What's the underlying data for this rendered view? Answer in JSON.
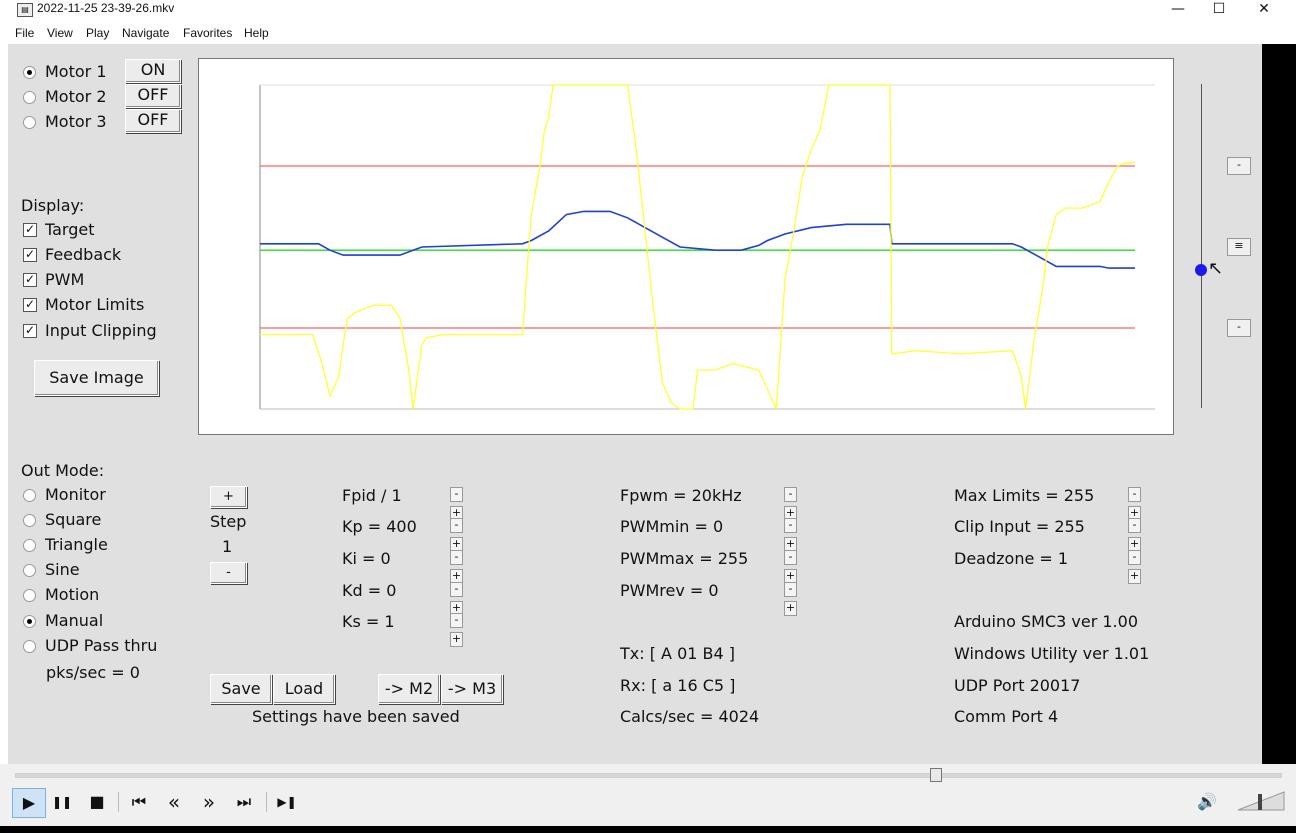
{
  "window": {
    "title": "2022-11-25 23-39-26.mkv",
    "minimize": "—",
    "maximize": "☐",
    "close": "✕"
  },
  "menu": [
    "File",
    "View",
    "Play",
    "Navigate",
    "Favorites",
    "Help"
  ],
  "motors": [
    {
      "label": "Motor 1",
      "selected": true,
      "state": "ON"
    },
    {
      "label": "Motor 2",
      "selected": false,
      "state": "OFF"
    },
    {
      "label": "Motor 3",
      "selected": false,
      "state": "OFF"
    }
  ],
  "display": {
    "heading": "Display:",
    "options": [
      {
        "label": "Target",
        "checked": true
      },
      {
        "label": "Feedback",
        "checked": true
      },
      {
        "label": "PWM",
        "checked": true
      },
      {
        "label": "Motor Limits",
        "checked": true
      },
      {
        "label": "Input Clipping",
        "checked": true
      }
    ],
    "save_image": "Save Image"
  },
  "out_mode": {
    "heading": "Out Mode:",
    "options": [
      {
        "label": "Monitor",
        "selected": false
      },
      {
        "label": "Square",
        "selected": false
      },
      {
        "label": "Triangle",
        "selected": false
      },
      {
        "label": "Sine",
        "selected": false
      },
      {
        "label": "Motion",
        "selected": false
      },
      {
        "label": "Manual",
        "selected": true
      },
      {
        "label": "UDP Pass thru",
        "selected": false
      }
    ],
    "pks": "pks/sec = 0"
  },
  "step": {
    "plus": "+",
    "label": "Step",
    "value": "1",
    "minus": "-"
  },
  "pid": [
    "Fpid / 1",
    "Kp = 400",
    "Ki = 0",
    "Kd = 0",
    "Ks = 1"
  ],
  "pwm": [
    "Fpwm = 20kHz",
    "PWMmin = 0",
    "PWMmax = 255",
    "PWMrev = 0"
  ],
  "limits": [
    "Max Limits = 255",
    "Clip Input = 255",
    "Deadzone = 1"
  ],
  "pm_labels": {
    "minus": "-",
    "plus": "+"
  },
  "info": [
    "Arduino SMC3 ver 1.00",
    "Windows Utility ver 1.01",
    "UDP Port 20017",
    "Comm Port 4"
  ],
  "comm": {
    "tx": "Tx: [ A 01 B4 ]",
    "rx": "Rx: [ a 16 C5 ]",
    "calcs": "Calcs/sec = 4024"
  },
  "buttons": {
    "save": "Save",
    "load": "Load",
    "to_m2": "-> M2",
    "to_m3": "-> M3"
  },
  "status": "Settings have been saved",
  "slider_buttons": [
    "-",
    "≡",
    "-"
  ],
  "player": {
    "play": "▶",
    "pause": "❚❚",
    "stop": "■",
    "prev": "⏮",
    "rew": "«",
    "fwd": "»",
    "next": "⏭",
    "frame": "▶❚",
    "volume": "🔊",
    "position": 0.727
  },
  "chart_data": {
    "type": "line",
    "title": "",
    "xlabel": "",
    "ylabel": "",
    "ylim": [
      0,
      100
    ],
    "grid": false,
    "series": [
      {
        "name": "",
        "role": "limit-top",
        "color": "#ff6060",
        "points": [
          [
            0,
            75
          ],
          [
            100,
            75
          ]
        ]
      },
      {
        "name": "",
        "role": "limit-bottom",
        "color": "#ff6060",
        "points": [
          [
            0,
            25
          ],
          [
            100,
            25
          ]
        ]
      },
      {
        "name": "",
        "role": "target",
        "color": "#22dd22",
        "points": [
          [
            0,
            49
          ],
          [
            100,
            49
          ]
        ]
      },
      {
        "name": "",
        "role": "feedback",
        "color": "#1f3fd6",
        "points": [
          [
            0,
            51
          ],
          [
            6.7,
            51
          ],
          [
            8,
            49
          ],
          [
            9.5,
            47.5
          ],
          [
            16,
            47.5
          ],
          [
            17.5,
            49
          ],
          [
            18.5,
            50
          ],
          [
            30,
            51
          ],
          [
            31,
            52
          ],
          [
            33,
            55
          ],
          [
            35,
            60
          ],
          [
            37,
            61
          ],
          [
            40,
            61
          ],
          [
            42,
            59
          ],
          [
            44,
            56
          ],
          [
            46,
            53
          ],
          [
            48,
            50
          ],
          [
            52,
            49
          ],
          [
            55,
            49
          ],
          [
            57,
            50.5
          ],
          [
            58,
            52
          ],
          [
            60,
            54
          ],
          [
            63,
            56
          ],
          [
            67,
            57
          ],
          [
            72,
            57
          ],
          [
            72.2,
            51
          ],
          [
            86,
            51
          ],
          [
            87,
            50
          ],
          [
            89,
            47
          ],
          [
            91,
            44
          ],
          [
            96,
            44
          ],
          [
            97,
            43.5
          ],
          [
            100,
            43.5
          ]
        ]
      },
      {
        "name": "",
        "role": "pwm",
        "color": "#ffff33",
        "points": [
          [
            0,
            23
          ],
          [
            6,
            23
          ],
          [
            7,
            15
          ],
          [
            8,
            4
          ],
          [
            9,
            10
          ],
          [
            9.5,
            20
          ],
          [
            10,
            28
          ],
          [
            11,
            30
          ],
          [
            13,
            32
          ],
          [
            15,
            32
          ],
          [
            16,
            28
          ],
          [
            17,
            12
          ],
          [
            17.5,
            0
          ],
          [
            18.5,
            20
          ],
          [
            19,
            22
          ],
          [
            21,
            23
          ],
          [
            30,
            23
          ],
          [
            30.5,
            42
          ],
          [
            31,
            60
          ],
          [
            32,
            75
          ],
          [
            32.5,
            86
          ],
          [
            33,
            90
          ],
          [
            33.5,
            100
          ],
          [
            42,
            100
          ],
          [
            43,
            80
          ],
          [
            44,
            55
          ],
          [
            45,
            30
          ],
          [
            46,
            8
          ],
          [
            47,
            2
          ],
          [
            48,
            0
          ],
          [
            49.5,
            0
          ],
          [
            50,
            12
          ],
          [
            52,
            12
          ],
          [
            54,
            14
          ],
          [
            57,
            12
          ],
          [
            59,
            0
          ],
          [
            60,
            40
          ],
          [
            61,
            55
          ],
          [
            62,
            72
          ],
          [
            63,
            80
          ],
          [
            64,
            86
          ],
          [
            65,
            100
          ],
          [
            72,
            100
          ],
          [
            72.2,
            17
          ],
          [
            75,
            18
          ],
          [
            80,
            17
          ],
          [
            86,
            18
          ],
          [
            87,
            10
          ],
          [
            87.5,
            0
          ],
          [
            88.5,
            22
          ],
          [
            89.5,
            38
          ],
          [
            90,
            50
          ],
          [
            91,
            60
          ],
          [
            92,
            62
          ],
          [
            94,
            62
          ],
          [
            96,
            64
          ],
          [
            97,
            70
          ],
          [
            98,
            75
          ],
          [
            99,
            76
          ],
          [
            100,
            76
          ]
        ]
      }
    ]
  }
}
